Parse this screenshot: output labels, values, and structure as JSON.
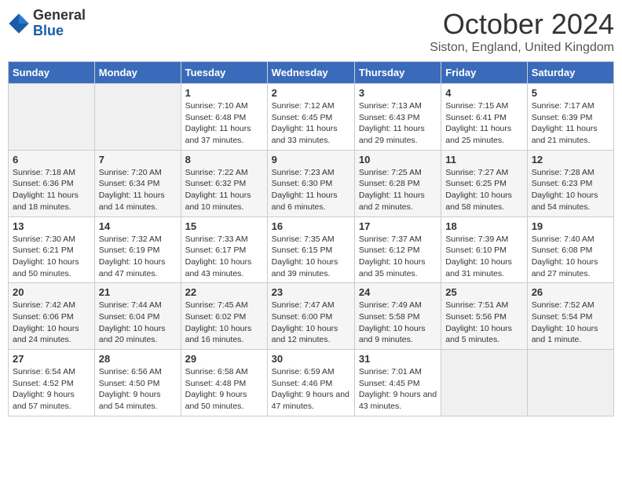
{
  "logo": {
    "general": "General",
    "blue": "Blue"
  },
  "title": "October 2024",
  "location": "Siston, England, United Kingdom",
  "days_of_week": [
    "Sunday",
    "Monday",
    "Tuesday",
    "Wednesday",
    "Thursday",
    "Friday",
    "Saturday"
  ],
  "weeks": [
    [
      {
        "day": "",
        "info": ""
      },
      {
        "day": "",
        "info": ""
      },
      {
        "day": "1",
        "info": "Sunrise: 7:10 AM\nSunset: 6:48 PM\nDaylight: 11 hours and 37 minutes."
      },
      {
        "day": "2",
        "info": "Sunrise: 7:12 AM\nSunset: 6:45 PM\nDaylight: 11 hours and 33 minutes."
      },
      {
        "day": "3",
        "info": "Sunrise: 7:13 AM\nSunset: 6:43 PM\nDaylight: 11 hours and 29 minutes."
      },
      {
        "day": "4",
        "info": "Sunrise: 7:15 AM\nSunset: 6:41 PM\nDaylight: 11 hours and 25 minutes."
      },
      {
        "day": "5",
        "info": "Sunrise: 7:17 AM\nSunset: 6:39 PM\nDaylight: 11 hours and 21 minutes."
      }
    ],
    [
      {
        "day": "6",
        "info": "Sunrise: 7:18 AM\nSunset: 6:36 PM\nDaylight: 11 hours and 18 minutes."
      },
      {
        "day": "7",
        "info": "Sunrise: 7:20 AM\nSunset: 6:34 PM\nDaylight: 11 hours and 14 minutes."
      },
      {
        "day": "8",
        "info": "Sunrise: 7:22 AM\nSunset: 6:32 PM\nDaylight: 11 hours and 10 minutes."
      },
      {
        "day": "9",
        "info": "Sunrise: 7:23 AM\nSunset: 6:30 PM\nDaylight: 11 hours and 6 minutes."
      },
      {
        "day": "10",
        "info": "Sunrise: 7:25 AM\nSunset: 6:28 PM\nDaylight: 11 hours and 2 minutes."
      },
      {
        "day": "11",
        "info": "Sunrise: 7:27 AM\nSunset: 6:25 PM\nDaylight: 10 hours and 58 minutes."
      },
      {
        "day": "12",
        "info": "Sunrise: 7:28 AM\nSunset: 6:23 PM\nDaylight: 10 hours and 54 minutes."
      }
    ],
    [
      {
        "day": "13",
        "info": "Sunrise: 7:30 AM\nSunset: 6:21 PM\nDaylight: 10 hours and 50 minutes."
      },
      {
        "day": "14",
        "info": "Sunrise: 7:32 AM\nSunset: 6:19 PM\nDaylight: 10 hours and 47 minutes."
      },
      {
        "day": "15",
        "info": "Sunrise: 7:33 AM\nSunset: 6:17 PM\nDaylight: 10 hours and 43 minutes."
      },
      {
        "day": "16",
        "info": "Sunrise: 7:35 AM\nSunset: 6:15 PM\nDaylight: 10 hours and 39 minutes."
      },
      {
        "day": "17",
        "info": "Sunrise: 7:37 AM\nSunset: 6:12 PM\nDaylight: 10 hours and 35 minutes."
      },
      {
        "day": "18",
        "info": "Sunrise: 7:39 AM\nSunset: 6:10 PM\nDaylight: 10 hours and 31 minutes."
      },
      {
        "day": "19",
        "info": "Sunrise: 7:40 AM\nSunset: 6:08 PM\nDaylight: 10 hours and 27 minutes."
      }
    ],
    [
      {
        "day": "20",
        "info": "Sunrise: 7:42 AM\nSunset: 6:06 PM\nDaylight: 10 hours and 24 minutes."
      },
      {
        "day": "21",
        "info": "Sunrise: 7:44 AM\nSunset: 6:04 PM\nDaylight: 10 hours and 20 minutes."
      },
      {
        "day": "22",
        "info": "Sunrise: 7:45 AM\nSunset: 6:02 PM\nDaylight: 10 hours and 16 minutes."
      },
      {
        "day": "23",
        "info": "Sunrise: 7:47 AM\nSunset: 6:00 PM\nDaylight: 10 hours and 12 minutes."
      },
      {
        "day": "24",
        "info": "Sunrise: 7:49 AM\nSunset: 5:58 PM\nDaylight: 10 hours and 9 minutes."
      },
      {
        "day": "25",
        "info": "Sunrise: 7:51 AM\nSunset: 5:56 PM\nDaylight: 10 hours and 5 minutes."
      },
      {
        "day": "26",
        "info": "Sunrise: 7:52 AM\nSunset: 5:54 PM\nDaylight: 10 hours and 1 minute."
      }
    ],
    [
      {
        "day": "27",
        "info": "Sunrise: 6:54 AM\nSunset: 4:52 PM\nDaylight: 9 hours and 57 minutes."
      },
      {
        "day": "28",
        "info": "Sunrise: 6:56 AM\nSunset: 4:50 PM\nDaylight: 9 hours and 54 minutes."
      },
      {
        "day": "29",
        "info": "Sunrise: 6:58 AM\nSunset: 4:48 PM\nDaylight: 9 hours and 50 minutes."
      },
      {
        "day": "30",
        "info": "Sunrise: 6:59 AM\nSunset: 4:46 PM\nDaylight: 9 hours and 47 minutes."
      },
      {
        "day": "31",
        "info": "Sunrise: 7:01 AM\nSunset: 4:45 PM\nDaylight: 9 hours and 43 minutes."
      },
      {
        "day": "",
        "info": ""
      },
      {
        "day": "",
        "info": ""
      }
    ]
  ]
}
